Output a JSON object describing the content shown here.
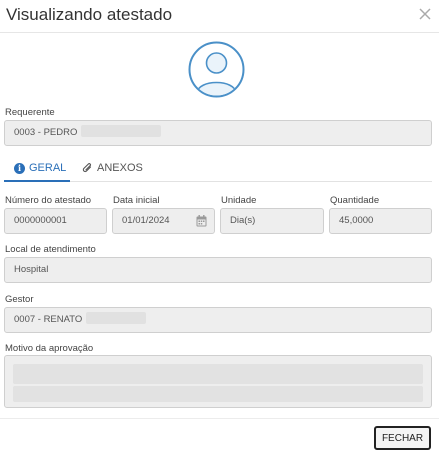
{
  "modal": {
    "title": "Visualizando atestado",
    "close_button": "FECHAR"
  },
  "requerente": {
    "label": "Requerente",
    "value": "0003 - PEDRO"
  },
  "tabs": [
    {
      "label": "GERAL",
      "icon": "info-icon",
      "active": true
    },
    {
      "label": "ANEXOS",
      "icon": "paperclip-icon",
      "active": false
    }
  ],
  "fields": {
    "numero": {
      "label": "Número do atestado",
      "value": "0000000001"
    },
    "data_inicial": {
      "label": "Data inicial",
      "value": "01/01/2024"
    },
    "unidade": {
      "label": "Unidade",
      "value": "Dia(s)"
    },
    "quantidade": {
      "label": "Quantidade",
      "value": "45,0000"
    },
    "local": {
      "label": "Local de atendimento",
      "value": "Hospital"
    },
    "gestor": {
      "label": "Gestor",
      "value": "0007 - RENATO"
    },
    "motivo": {
      "label": "Motivo da aprovação"
    }
  },
  "colors": {
    "accent": "#2a6fb8",
    "field_bg": "#eeeeee",
    "avatar": "#4a90c8"
  }
}
